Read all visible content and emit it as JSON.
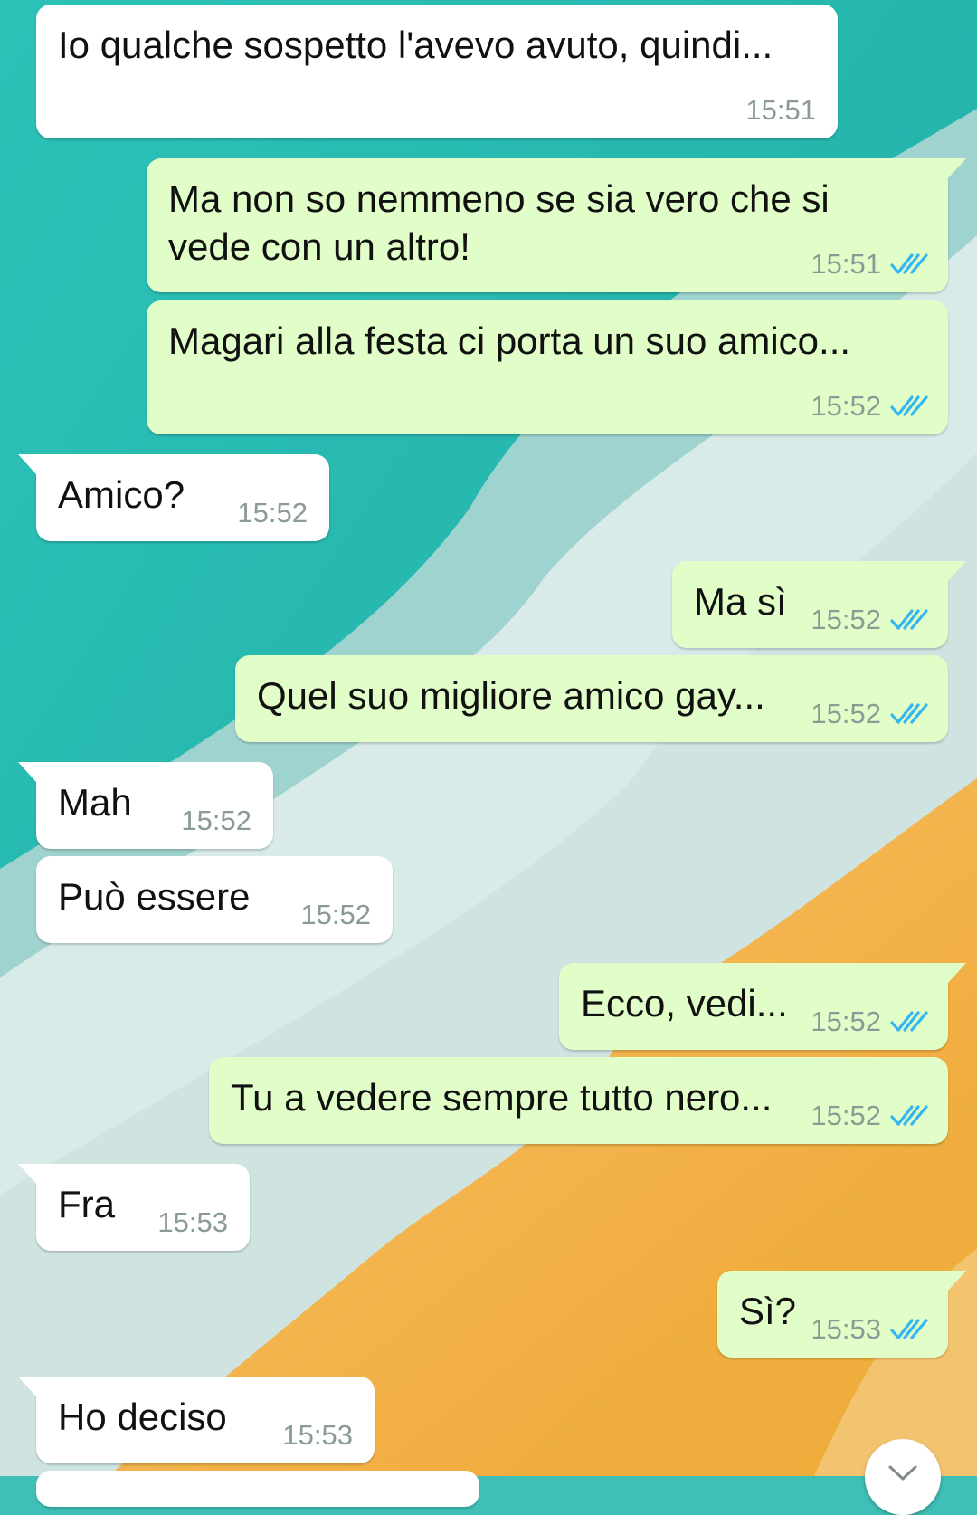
{
  "colors": {
    "incoming_bubble": "#ffffff",
    "outgoing_bubble": "#e1fdc8",
    "read_ticks": "#34b7f1",
    "timestamp": "#8a9a94"
  },
  "messages": [
    {
      "direction": "in",
      "text": "Io qualche sospetto l'avevo avuto, quindi...",
      "time": "15:51"
    },
    {
      "direction": "out",
      "text": "Ma non so nemmeno se sia vero che si\nvede con un altro!",
      "time": "15:51",
      "status": "read"
    },
    {
      "direction": "out",
      "text": "Magari alla festa ci porta un suo amico...",
      "time": "15:52",
      "status": "read"
    },
    {
      "direction": "in",
      "text": "Amico?",
      "time": "15:52"
    },
    {
      "direction": "out",
      "text": "Ma sì",
      "time": "15:52",
      "status": "read"
    },
    {
      "direction": "out",
      "text": "Quel suo migliore amico gay...",
      "time": "15:52",
      "status": "read"
    },
    {
      "direction": "in",
      "text": "Mah",
      "time": "15:52"
    },
    {
      "direction": "in",
      "text": "Può essere",
      "time": "15:52"
    },
    {
      "direction": "out",
      "text": "Ecco, vedi...",
      "time": "15:52",
      "status": "read"
    },
    {
      "direction": "out",
      "text": "Tu a vedere sempre tutto nero...",
      "time": "15:52",
      "status": "read"
    },
    {
      "direction": "in",
      "text": "Fra",
      "time": "15:53"
    },
    {
      "direction": "out",
      "text": "Sì?",
      "time": "15:53",
      "status": "read"
    },
    {
      "direction": "in",
      "text": "Ho deciso",
      "time": "15:53"
    }
  ],
  "scroll_button": {
    "icon": "chevron-down-icon"
  }
}
